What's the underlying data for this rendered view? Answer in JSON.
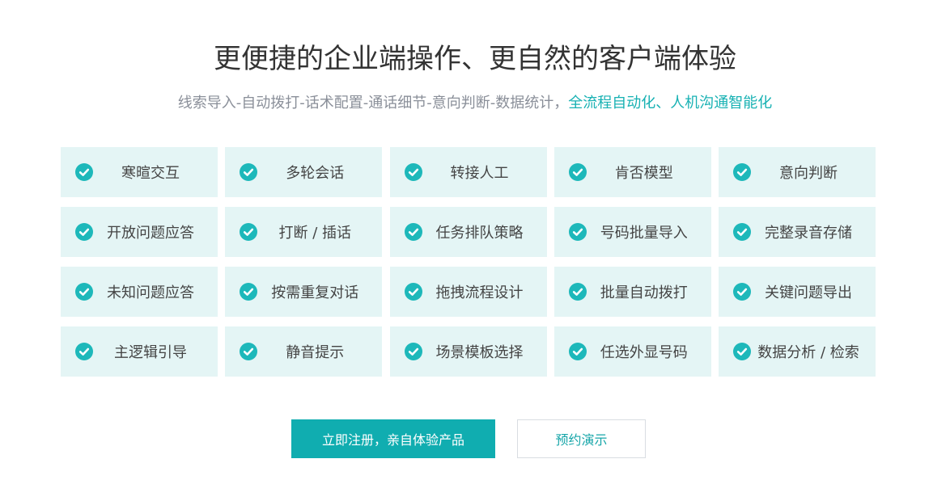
{
  "header": {
    "title": "更便捷的企业端操作、更自然的客户端体验",
    "subtitle_plain": "线索导入-自动拨打-话术配置-通话细节-意向判断-数据统计，",
    "subtitle_highlight": "全流程自动化、人机沟通智能化"
  },
  "features": {
    "icon": "check-circle-icon",
    "items": [
      {
        "label": "寒暄交互"
      },
      {
        "label": "多轮会话"
      },
      {
        "label": "转接人工"
      },
      {
        "label": "肯否模型"
      },
      {
        "label": "意向判断"
      },
      {
        "label": "开放问题应答"
      },
      {
        "label": "打断 / 插话"
      },
      {
        "label": "任务排队策略"
      },
      {
        "label": "号码批量导入"
      },
      {
        "label": "完整录音存储"
      },
      {
        "label": "未知问题应答"
      },
      {
        "label": "按需重复对话"
      },
      {
        "label": "拖拽流程设计"
      },
      {
        "label": "批量自动拨打"
      },
      {
        "label": "关键问题导出"
      },
      {
        "label": "主逻辑引导"
      },
      {
        "label": "静音提示"
      },
      {
        "label": "场景模板选择"
      },
      {
        "label": "任选外显号码"
      },
      {
        "label": "数据分析 / 检索"
      }
    ]
  },
  "actions": {
    "primary_label": "立即注册，亲自体验产品",
    "secondary_label": "预约演示"
  },
  "colors": {
    "accent": "#10adb0",
    "cell_bg": "#e4f5f5",
    "check": "#1db8ba"
  }
}
